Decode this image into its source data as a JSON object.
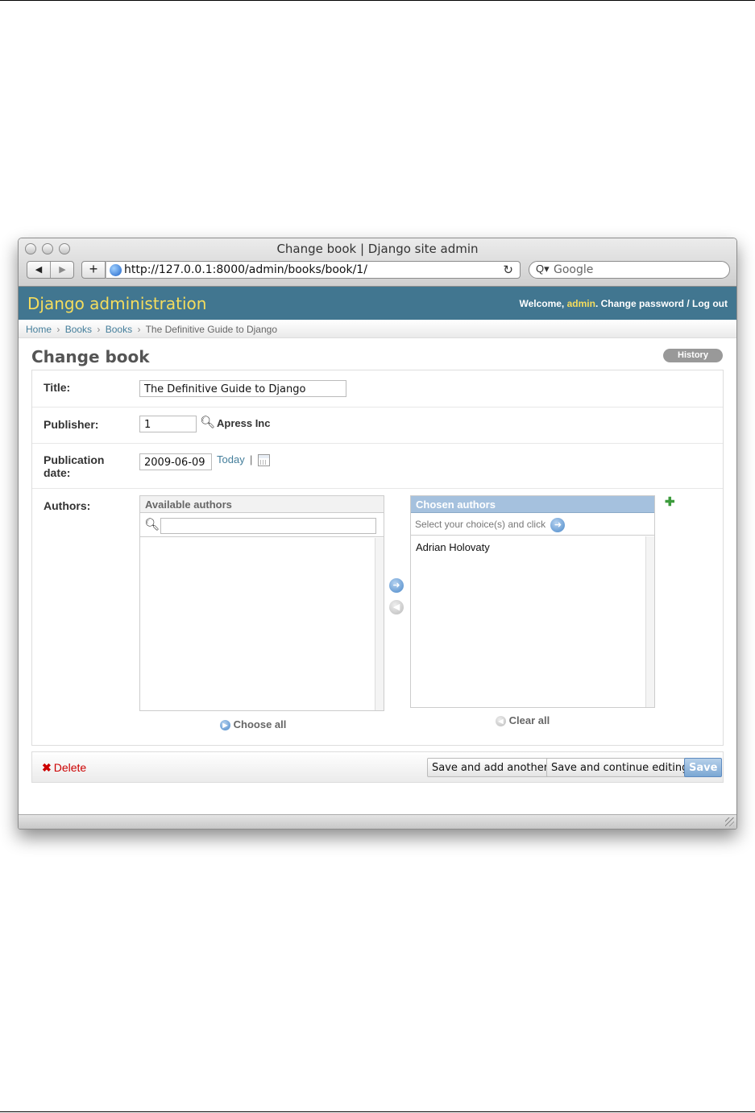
{
  "window": {
    "title": "Change book | Django site admin",
    "url": "http://127.0.0.1:8000/admin/books/book/1/",
    "search_placeholder": "Google",
    "nav_back": "◀",
    "nav_forward": "▶",
    "add_tab": "+",
    "reload": "↻",
    "search_glyph": "Q▾"
  },
  "header": {
    "branding": "Django administration",
    "welcome": "Welcome,",
    "username": "admin",
    "change_password": "Change password",
    "divider": "/",
    "logout": "Log out"
  },
  "breadcrumbs": [
    {
      "label": "Home"
    },
    {
      "label": "Books"
    },
    {
      "label": "Books"
    },
    {
      "label": "The Definitive Guide to Django"
    }
  ],
  "breadcrumb_separator": "›",
  "content": {
    "title": "Change book",
    "history_button": "History"
  },
  "form": {
    "title": {
      "label": "Title:",
      "value": "The Definitive Guide to Django"
    },
    "publisher": {
      "label": "Publisher:",
      "value": "1",
      "name": "Apress Inc"
    },
    "publication_date": {
      "label_line1": "Publication",
      "label_line2": "date:",
      "value": "2009-06-09",
      "today_link": "Today",
      "pipe": "|"
    },
    "authors": {
      "label": "Authors:",
      "available_title": "Available authors",
      "filter_value": "",
      "available_options": [],
      "choose_all": "Choose all",
      "chosen_title": "Chosen authors",
      "chosen_help": "Select your choice(s) and click",
      "chosen_options": [
        "Adrian Holovaty"
      ],
      "clear_all": "Clear all"
    }
  },
  "submit_row": {
    "delete": "Delete",
    "save_add_another": "Save and add another",
    "save_continue": "Save and continue editing",
    "save": "Save"
  },
  "colors": {
    "header_bg": "#417690",
    "branding": "#f5dd5d",
    "link": "#447e9b",
    "delete": "#cc0000",
    "chosen_header": "#a5c1de"
  },
  "icons": {
    "lookup": "magnifier-icon",
    "calendar": "calendar-icon",
    "add_related": "plus-icon",
    "move_right": "arrow-right-circle-icon",
    "move_left": "arrow-left-circle-icon"
  }
}
